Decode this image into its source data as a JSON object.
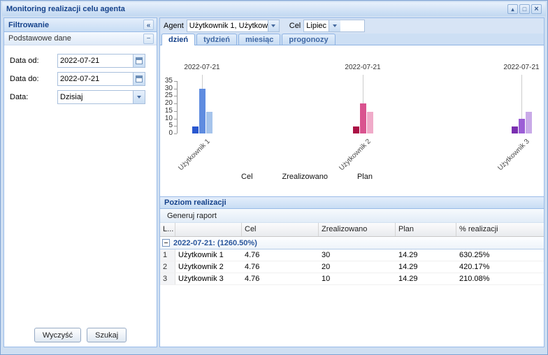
{
  "window": {
    "title": "Monitoring realizacji celu agenta"
  },
  "filter": {
    "title": "Filtrowanie",
    "section": "Podstawowe dane",
    "fields": [
      {
        "label": "Data od:",
        "value": "2022-07-21"
      },
      {
        "label": "Data do:",
        "value": "2022-07-21"
      },
      {
        "label": "Data:",
        "value": "Dzisiaj"
      }
    ],
    "clear_label": "Wyczyść",
    "search_label": "Szukaj"
  },
  "topbar": {
    "agent_label": "Agent",
    "agent_value": "Użytkownik 1, Użytkowr",
    "cel_label": "Cel",
    "cel_value": "Lipiec"
  },
  "tabs": [
    {
      "label": "dzień",
      "active": true
    },
    {
      "label": "tydzień",
      "active": false
    },
    {
      "label": "miesiąc",
      "active": false
    },
    {
      "label": "progonozy",
      "active": false
    }
  ],
  "chart_data": {
    "type": "bar",
    "title": "",
    "ylim": [
      0,
      35
    ],
    "yticks": [
      0,
      5,
      10,
      15,
      20,
      25,
      30,
      35
    ],
    "legend": [
      "Cel",
      "Zrealizowano",
      "Plan"
    ],
    "legend_position": "bottom",
    "grid": false,
    "groups": [
      {
        "category": "Użytkownik 1",
        "date_label": "2022-07-21",
        "series": {
          "Cel": 4.76,
          "Zrealizowano": 30,
          "Plan": 14.29
        },
        "colors": [
          "#2a57cf",
          "#5f8ce0",
          "#a6c4ec"
        ]
      },
      {
        "category": "Użytkownik 2",
        "date_label": "2022-07-21",
        "series": {
          "Cel": 4.76,
          "Zrealizowano": 20,
          "Plan": 14.29
        },
        "colors": [
          "#ab1145",
          "#d9538f",
          "#f0abc9"
        ]
      },
      {
        "category": "Użytkownik 3",
        "date_label": "2022-07-21",
        "series": {
          "Cel": 4.76,
          "Zrealizowano": 10,
          "Plan": 14.29
        },
        "colors": [
          "#7a2fb0",
          "#9c5ed6",
          "#c9aae8"
        ]
      }
    ]
  },
  "grid": {
    "title": "Poziom realizacji",
    "toolbar_button": "Generuj raport",
    "columns": [
      "L...",
      "",
      "Cel",
      "Zrealizowano",
      "Plan",
      "% realizacji"
    ],
    "group_label": "2022-07-21: (1260.50%)",
    "rows": [
      {
        "num": "1",
        "name": "Użytkownik 1",
        "cel": "4.76",
        "zrealizowano": "30",
        "plan": "14.29",
        "pct": "630.25%"
      },
      {
        "num": "2",
        "name": "Użytkownik 2",
        "cel": "4.76",
        "zrealizowano": "20",
        "plan": "14.29",
        "pct": "420.17%"
      },
      {
        "num": "3",
        "name": "Użytkownik 3",
        "cel": "4.76",
        "zrealizowano": "10",
        "plan": "14.29",
        "pct": "210.08%"
      }
    ]
  }
}
